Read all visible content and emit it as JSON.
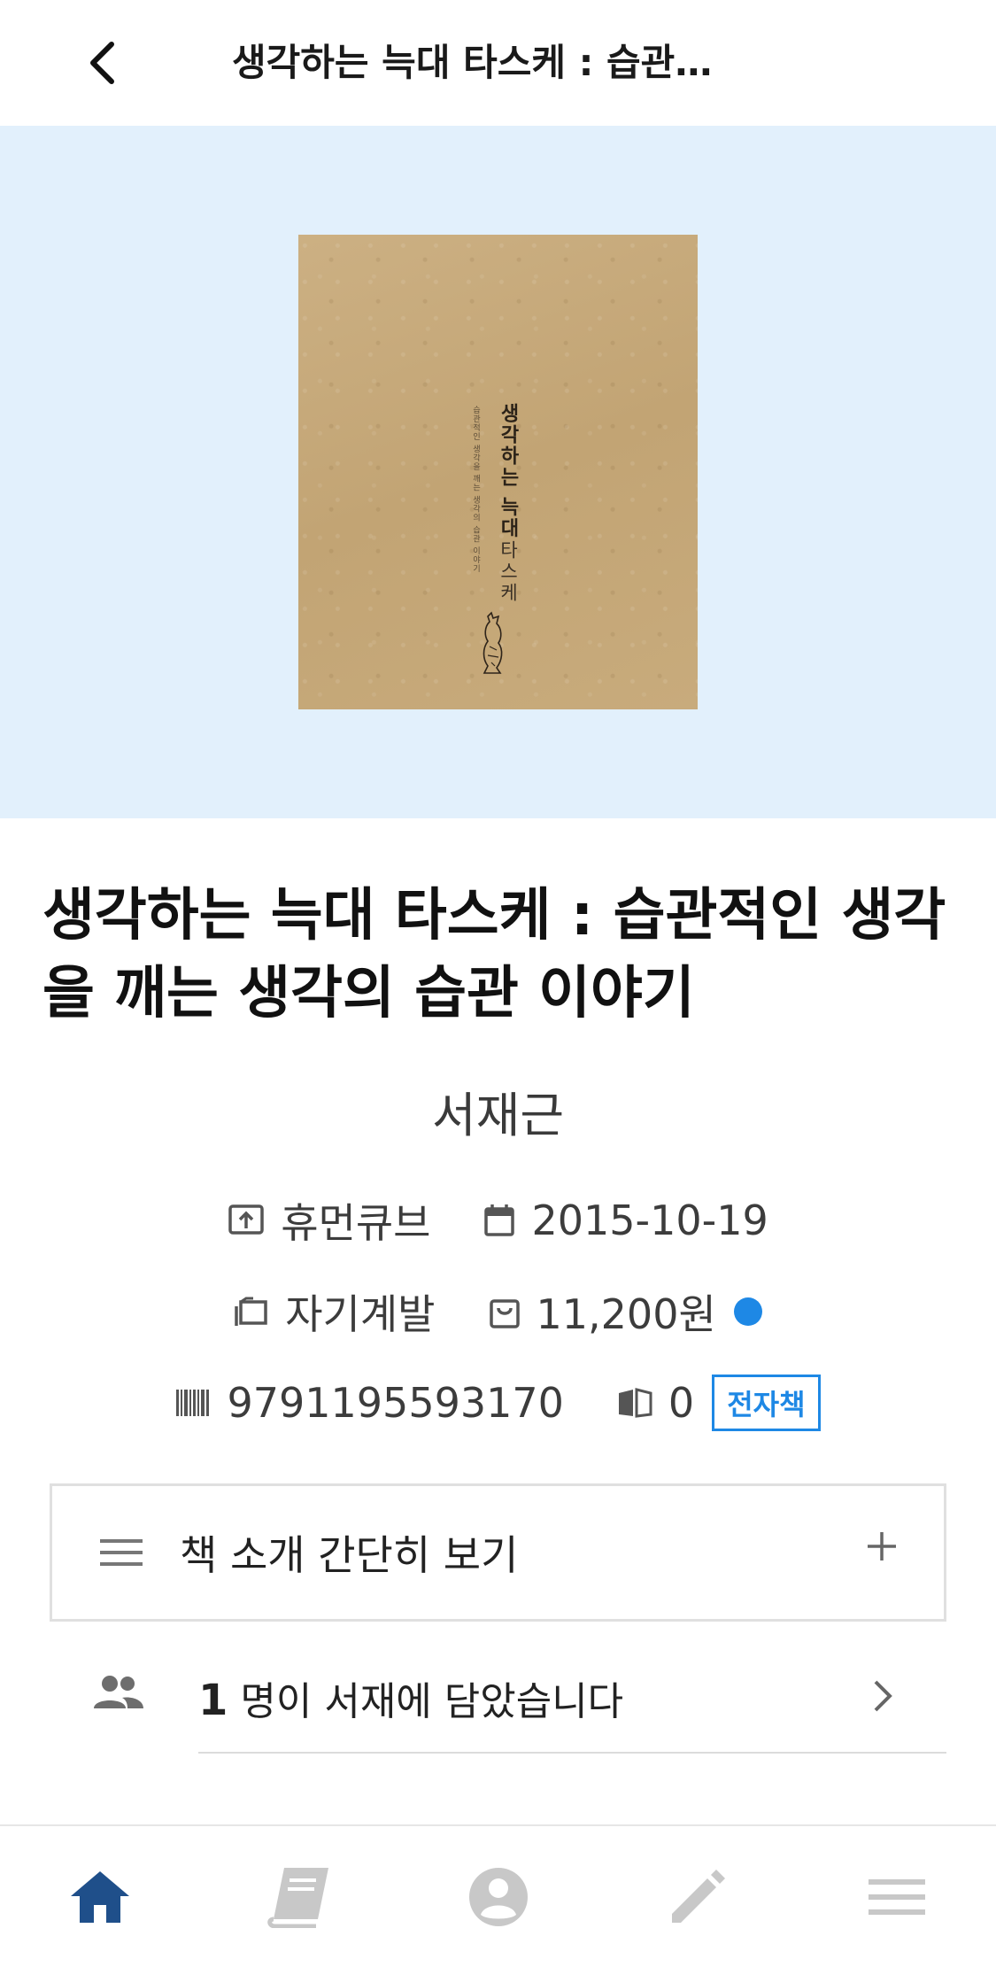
{
  "header": {
    "title": "생각하는 늑대 타스케 : 습관…",
    "back_icon": "chevron-left-icon"
  },
  "cover": {
    "title_vertical": "생각하는 늑대",
    "author_vertical": "타스케",
    "subtitle_vertical": "습관적인 생각을 깨는 생각의 습관 이야기"
  },
  "book": {
    "title": "생각하는 늑대 타스케 : 습관적인 생각을 깨는 생각의 습관 이야기",
    "author": "서재근",
    "publisher": "휴먼큐브",
    "date": "2015-10-19",
    "category": "자기계발",
    "price": "11,200원",
    "isbn": "9791195593170",
    "read_count": "0",
    "ebook_badge": "전자책"
  },
  "intro": {
    "label": "책 소개 간단히 보기"
  },
  "shelf": {
    "count": "1",
    "text": " 명이 서재에 담았습니다"
  },
  "colors": {
    "hero_bg": "#e2f0fc",
    "accent": "#1e88e5",
    "nav_active": "#1f4f8a",
    "nav_inactive": "#c8c8c8"
  },
  "bottom_nav": [
    {
      "icon": "home-icon",
      "active": true
    },
    {
      "icon": "book-icon",
      "active": false
    },
    {
      "icon": "profile-icon",
      "active": false
    },
    {
      "icon": "pencil-icon",
      "active": false
    },
    {
      "icon": "menu-icon",
      "active": false
    }
  ]
}
